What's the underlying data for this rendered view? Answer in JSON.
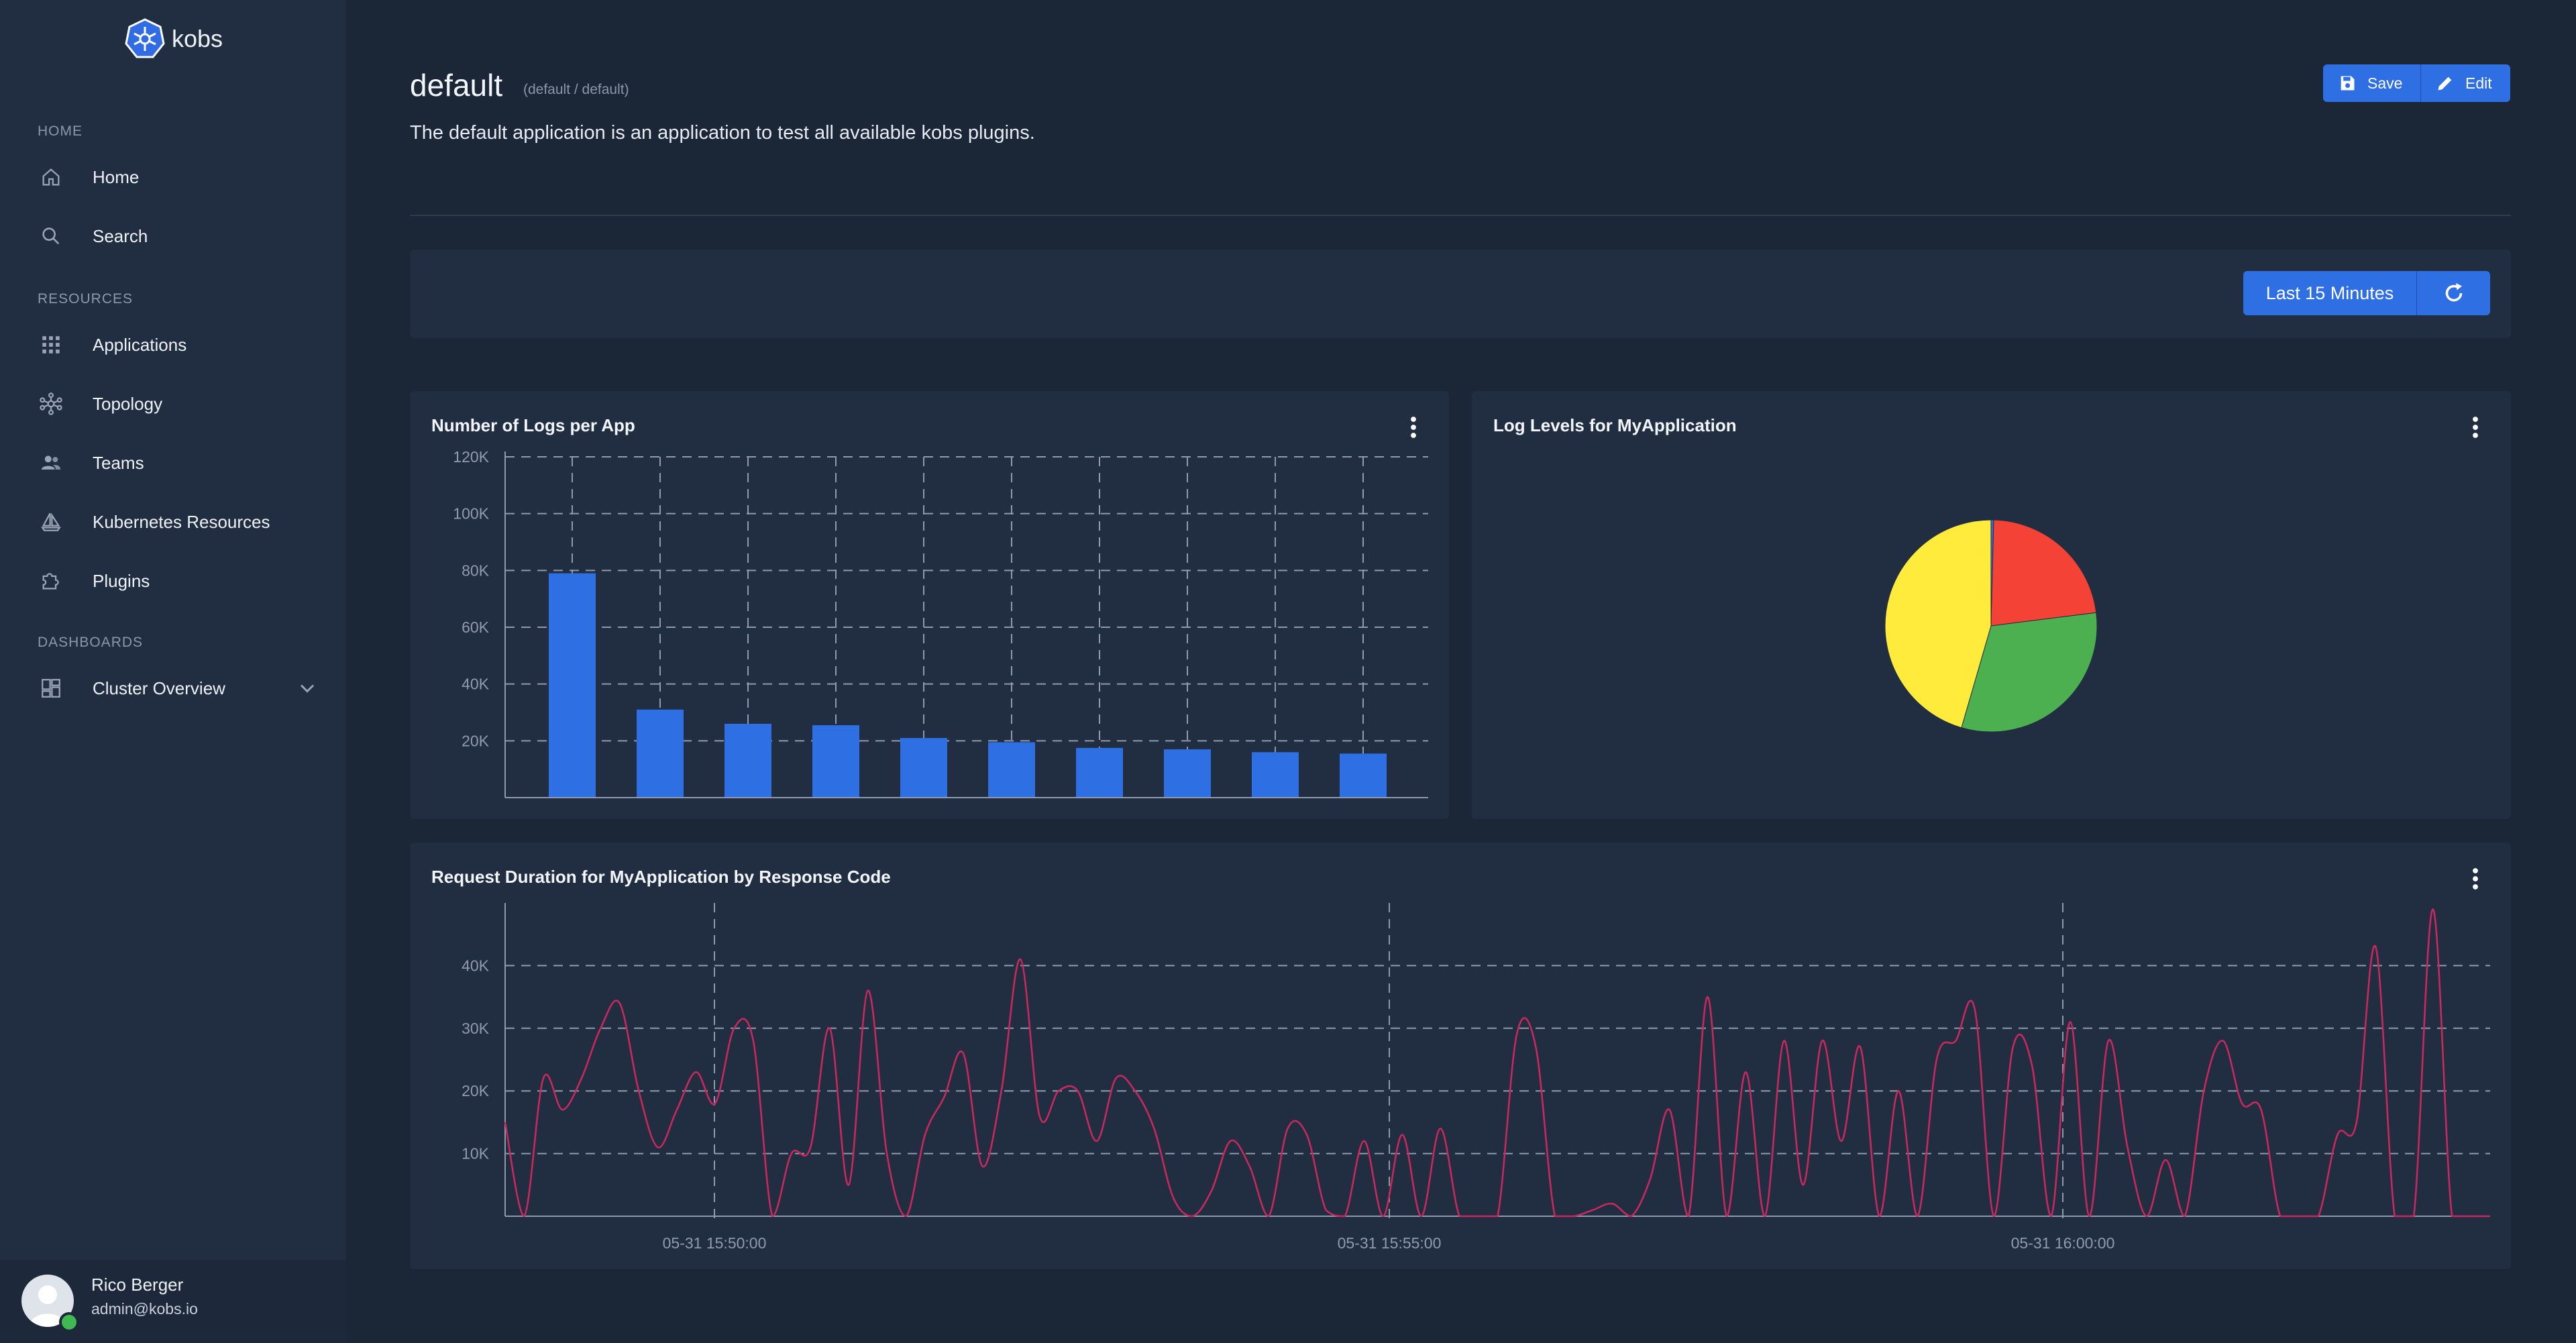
{
  "app": {
    "name": "kobs"
  },
  "sidebar": {
    "sections": [
      {
        "title": "HOME"
      },
      {
        "title": "RESOURCES"
      },
      {
        "title": "DASHBOARDS"
      }
    ],
    "items": [
      {
        "label": "Home",
        "icon": "home-icon"
      },
      {
        "label": "Search",
        "icon": "search-icon"
      },
      {
        "label": "Applications",
        "icon": "grid-icon"
      },
      {
        "label": "Topology",
        "icon": "topology-icon"
      },
      {
        "label": "Teams",
        "icon": "people-icon"
      },
      {
        "label": "Kubernetes Resources",
        "icon": "sailboat-icon"
      },
      {
        "label": "Plugins",
        "icon": "puzzle-icon"
      },
      {
        "label": "Cluster Overview",
        "icon": "dashboard-icon"
      }
    ]
  },
  "user": {
    "name": "Rico Berger",
    "email": "admin@kobs.io",
    "status_color": "#3fb950"
  },
  "header": {
    "title": "default",
    "subtitle": "(default / default)",
    "description": "The default application is an application to test all available kobs plugins.",
    "save_label": "Save",
    "edit_label": "Edit"
  },
  "toolbar": {
    "time_range_label": "Last 15 Minutes"
  },
  "colors": {
    "accent": "#2f6fe4",
    "bar": "#2f6fe4",
    "line": "#c7285d",
    "pie_red": "#f44336",
    "pie_green": "#4caf50",
    "pie_yellow": "#ffeb3b",
    "pie_blue": "#2f6fe4"
  },
  "chart_data": [
    {
      "type": "bar",
      "title": "Number of Logs per App",
      "categories": [
        "",
        "",
        "",
        "",
        "",
        "",
        "",
        "",
        "",
        ""
      ],
      "values": [
        79000,
        31000,
        26000,
        25500,
        21000,
        19500,
        17500,
        17000,
        16000,
        15500
      ],
      "yticks": [
        "20K",
        "40K",
        "60K",
        "80K",
        "100K",
        "120K"
      ],
      "ylim": [
        0,
        120000
      ],
      "grid": true
    },
    {
      "type": "pie",
      "title": "Log Levels for MyApplication",
      "slices": [
        {
          "value": 0.4,
          "color": "#2f6fe4"
        },
        {
          "value": 22.6,
          "color": "#f44336"
        },
        {
          "value": 31.5,
          "color": "#4caf50"
        },
        {
          "value": 45.5,
          "color": "#ffeb3b"
        }
      ]
    },
    {
      "type": "line",
      "title": "Request Duration for MyApplication by Response Code",
      "xticks": [
        "05-31 15:50:00",
        "05-31 15:55:00",
        "05-31 16:00:00"
      ],
      "yticks": [
        "10K",
        "20K",
        "30K",
        "40K"
      ],
      "ylim": [
        0,
        50000
      ],
      "grid": true,
      "series": [
        {
          "color": "#c7285d",
          "values": [
            15000,
            0,
            22000,
            17000,
            22000,
            30000,
            34000,
            20000,
            11000,
            17000,
            23000,
            18000,
            30000,
            28000,
            0,
            10000,
            11000,
            30000,
            5000,
            36000,
            10000,
            0,
            13000,
            19000,
            26000,
            8000,
            20000,
            41000,
            16000,
            20000,
            20000,
            12000,
            22000,
            20000,
            14000,
            3000,
            0,
            4000,
            12000,
            8000,
            0,
            14000,
            13000,
            1000,
            0,
            12000,
            0,
            13000,
            0,
            14000,
            0,
            0,
            0,
            29000,
            27000,
            0,
            0,
            1000,
            2000,
            0,
            6000,
            17000,
            0,
            35000,
            0,
            23000,
            0,
            28000,
            5000,
            28000,
            12000,
            27000,
            0,
            20000,
            0,
            25000,
            28000,
            33000,
            0,
            27000,
            24000,
            0,
            31000,
            0,
            28000,
            11000,
            0,
            9000,
            0,
            20000,
            28000,
            18000,
            17000,
            0,
            0,
            0,
            13000,
            15000,
            43000,
            0,
            0,
            49000,
            0,
            0,
            0
          ]
        }
      ]
    }
  ]
}
